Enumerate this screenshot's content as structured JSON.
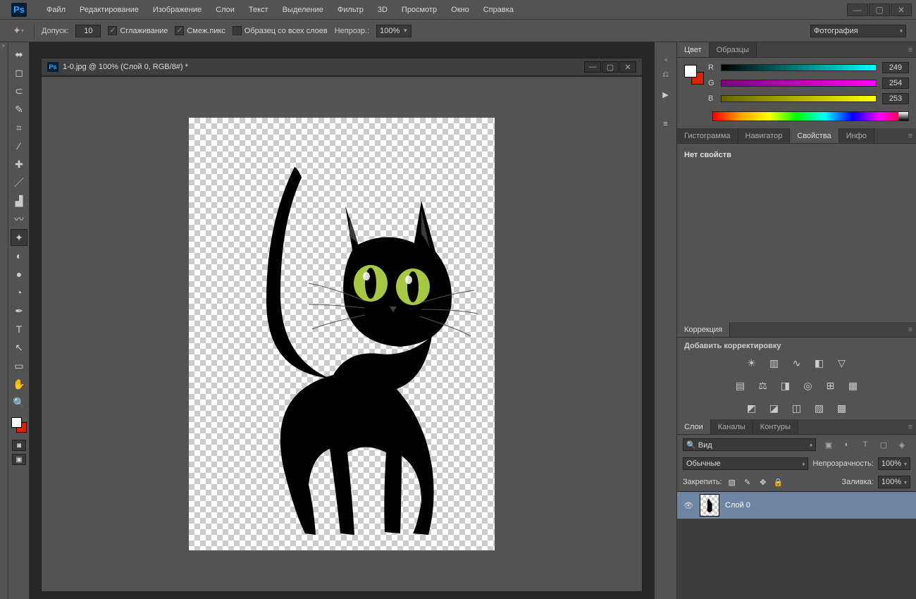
{
  "app": {
    "logo": "Ps"
  },
  "menus": [
    "Файл",
    "Редактирование",
    "Изображение",
    "Слои",
    "Текст",
    "Выделение",
    "Фильтр",
    "3D",
    "Просмотр",
    "Окно",
    "Справка"
  ],
  "options": {
    "tolerance_label": "Допуск:",
    "tolerance_value": "10",
    "anti_alias": "Сглаживание",
    "contiguous": "Смеж.пикс",
    "all_layers": "Образец со всех слоев",
    "opacity_label": "Непрозр.:",
    "opacity_value": "100%",
    "workspace": "Фотография"
  },
  "document": {
    "title": "1-0.jpg @ 100% (Слой 0, RGB/8#) *"
  },
  "color_panel": {
    "tabs": [
      "Цвет",
      "Образцы"
    ],
    "channels": [
      {
        "label": "R",
        "value": "249"
      },
      {
        "label": "G",
        "value": "254"
      },
      {
        "label": "B",
        "value": "253"
      }
    ]
  },
  "props_panel": {
    "tabs": [
      "Гистограмма",
      "Навигатор",
      "Свойства",
      "Инфо"
    ],
    "active": 2,
    "no_props": "Нет свойств"
  },
  "adjustments_panel": {
    "tab": "Коррекция",
    "add_label": "Добавить корректировку"
  },
  "layers_panel": {
    "tabs": [
      "Слои",
      "Каналы",
      "Контуры"
    ],
    "filter": "Вид",
    "blend_mode": "Обычные",
    "opacity_label": "Непрозрачность:",
    "opacity_value": "100%",
    "lock_label": "Закрепить:",
    "fill_label": "Заливка:",
    "fill_value": "100%",
    "layer_name": "Слой 0"
  }
}
